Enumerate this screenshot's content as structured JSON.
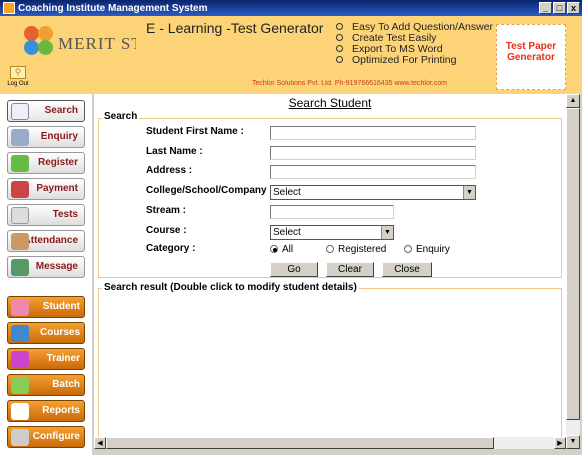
{
  "window": {
    "title": "Coaching Institute Management System",
    "min": "_",
    "max": "□",
    "close": "x"
  },
  "header": {
    "logo_text": "MERIT STU",
    "logout_label": "Log Out",
    "app_title": "E - Learning -Test Generator",
    "features": [
      "Easy To Add Question/Answer",
      "Create Test Easily",
      "Export To MS Word",
      "Optimized For Printing"
    ],
    "credit": "Techlor Solutions Pvt. Ltd. Ph-919766616435 www.techlor.com",
    "badge_line1": "Test Paper",
    "badge_line2": "Generator"
  },
  "sidebar": {
    "top_items": [
      "Search",
      "Enquiry",
      "Register",
      "Payment",
      "Tests",
      "Attendance",
      "Message"
    ],
    "bottom_items": [
      "Student",
      "Courses",
      "Trainer",
      "Batch",
      "Reports",
      "Configure"
    ]
  },
  "form": {
    "page_title": "Search Student",
    "section_label": "Search",
    "first_name_label": "Student First Name :",
    "last_name_label": "Last Name :",
    "address_label": "Address :",
    "college_label": "College/School/Company :",
    "college_value": "Select",
    "stream_label": "Stream :",
    "course_label": "Course :",
    "course_value": "Select",
    "category_label": "Category :",
    "category_options": [
      "All",
      "Registered",
      "Enquiry"
    ],
    "category_selected": "All",
    "go": "Go",
    "clear": "Clear",
    "close": "Close",
    "result_label": "Search result (Double click to modify student details)"
  }
}
